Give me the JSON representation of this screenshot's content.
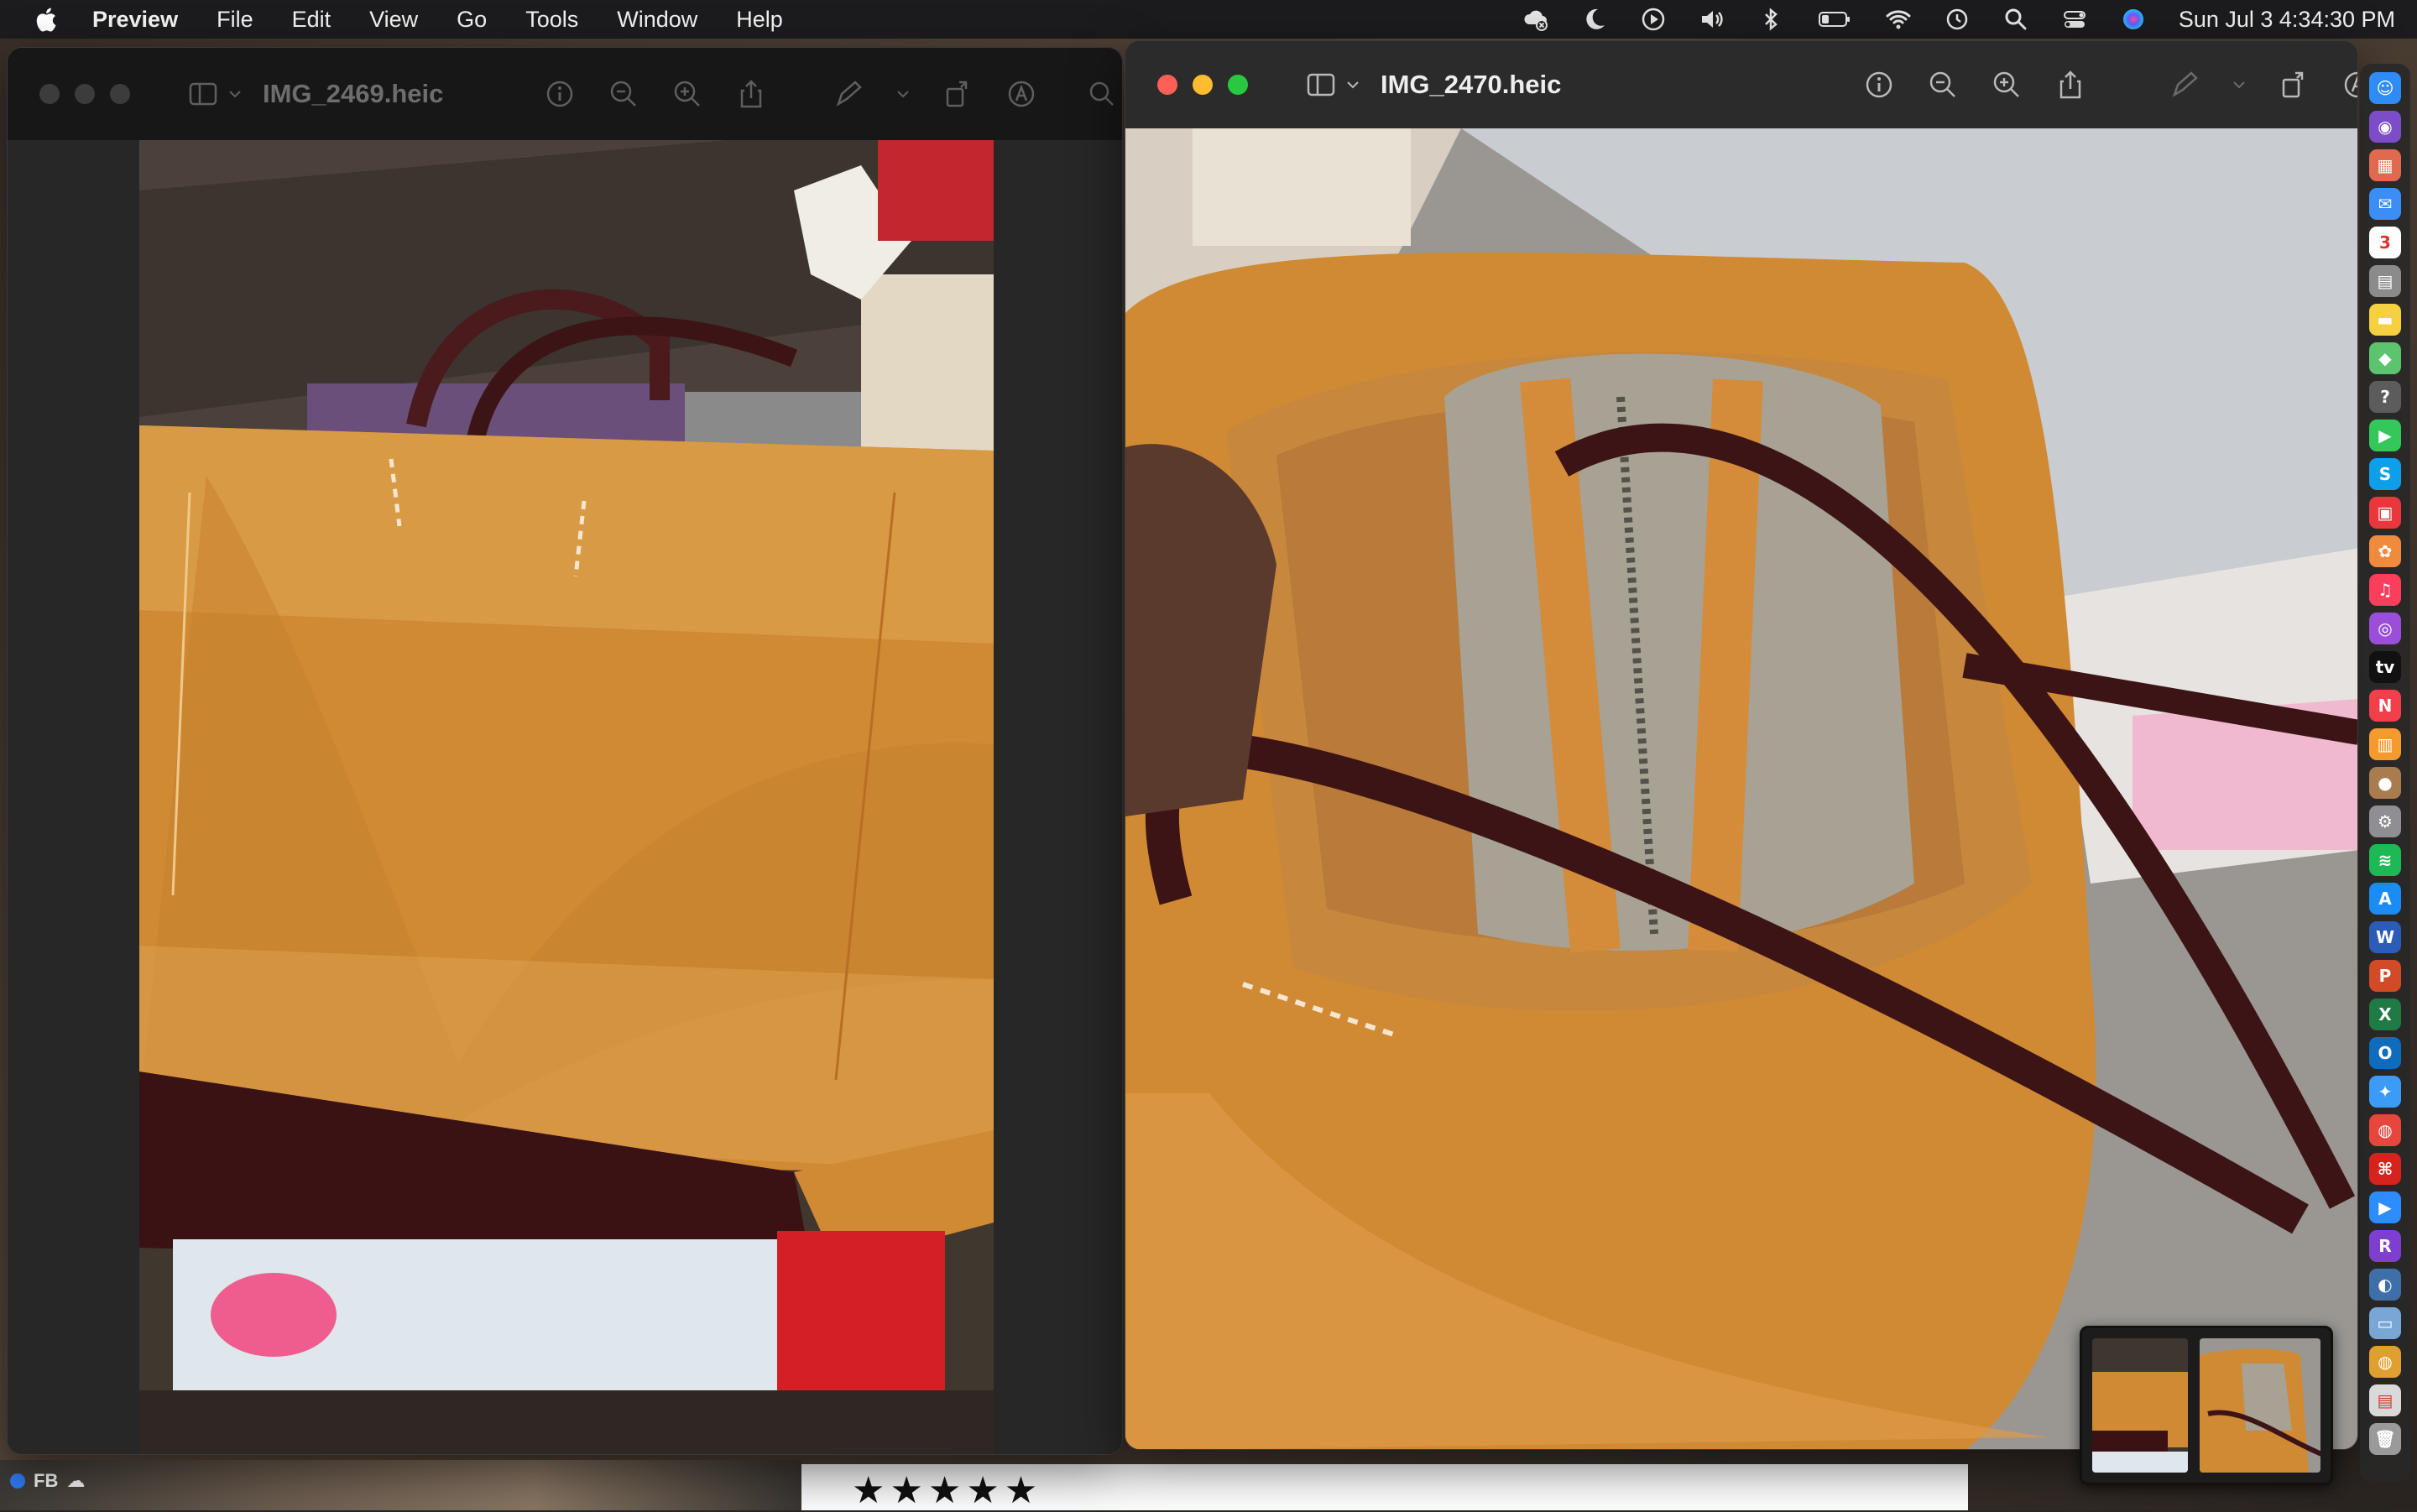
{
  "menubar": {
    "app_name": "Preview",
    "menus": [
      "File",
      "Edit",
      "View",
      "Go",
      "Tools",
      "Window",
      "Help"
    ],
    "clock": "Sun Jul 3  4:34:30 PM",
    "status_icons": [
      "icloud-error-icon",
      "moon-icon",
      "play-icon",
      "volume-icon",
      "bluetooth-icon",
      "battery-icon",
      "wifi-icon",
      "time-machine-icon",
      "search-icon",
      "control-center-icon",
      "siri-icon"
    ]
  },
  "windows": {
    "left": {
      "title": "IMG_2469.heic",
      "active": false
    },
    "right": {
      "title": "IMG_2470.heic",
      "active": true
    }
  },
  "toolbar_icons": [
    "info-icon",
    "zoom-out-icon",
    "zoom-in-icon",
    "share-icon",
    "markup-icon",
    "markup-chevron-icon",
    "rotate-icon",
    "annotate-icon"
  ],
  "desktop": {
    "fb_label": "FB",
    "stars": "★★★★★"
  },
  "dock": {
    "apps": [
      {
        "name": "finder",
        "glyph": "☺",
        "color": "#2f8cf6"
      },
      {
        "name": "siri",
        "glyph": "◉",
        "color": "#7d4cc8"
      },
      {
        "name": "launchpad",
        "glyph": "▦",
        "color": "#e06a4f"
      },
      {
        "name": "mail",
        "glyph": "✉",
        "color": "#3a8ef6"
      },
      {
        "name": "calendar",
        "glyph": "3",
        "color": "#ffffff"
      },
      {
        "name": "calculator",
        "glyph": "▤",
        "color": "#8b8b8b"
      },
      {
        "name": "notes",
        "glyph": "▬",
        "color": "#f5d142"
      },
      {
        "name": "maps",
        "glyph": "◆",
        "color": "#5cc46e"
      },
      {
        "name": "help",
        "glyph": "?",
        "color": "#5c5c5c"
      },
      {
        "name": "facetime",
        "glyph": "▶",
        "color": "#34c759"
      },
      {
        "name": "skype",
        "glyph": "S",
        "color": "#0e9fe8"
      },
      {
        "name": "photo-booth",
        "glyph": "▣",
        "color": "#e8383d"
      },
      {
        "name": "photos",
        "glyph": "✿",
        "color": "#f08a3c"
      },
      {
        "name": "music",
        "glyph": "♫",
        "color": "#fa3e5c"
      },
      {
        "name": "podcasts",
        "glyph": "◎",
        "color": "#9b4fd9"
      },
      {
        "name": "tv",
        "glyph": "tv",
        "color": "#111111"
      },
      {
        "name": "news",
        "glyph": "N",
        "color": "#f1404b"
      },
      {
        "name": "books",
        "glyph": "▥",
        "color": "#f59a2e"
      },
      {
        "name": "finder-dog",
        "glyph": "●",
        "color": "#a97c4f"
      },
      {
        "name": "system-preferences",
        "glyph": "⚙",
        "color": "#8e8e93"
      },
      {
        "name": "spotify",
        "glyph": "≋",
        "color": "#1db954"
      },
      {
        "name": "app-store",
        "glyph": "A",
        "color": "#1a8cf5"
      },
      {
        "name": "word",
        "glyph": "W",
        "color": "#2b5cb8"
      },
      {
        "name": "powerpoint",
        "glyph": "P",
        "color": "#d14b27"
      },
      {
        "name": "excel",
        "glyph": "X",
        "color": "#1f7a45"
      },
      {
        "name": "outlook",
        "glyph": "O",
        "color": "#0f6cbd"
      },
      {
        "name": "safari",
        "glyph": "✦",
        "color": "#3b9bf6"
      },
      {
        "name": "chrome",
        "glyph": "◍",
        "color": "#e8453c"
      },
      {
        "name": "acrobat",
        "glyph": "⌘",
        "color": "#d6231e"
      },
      {
        "name": "zoom",
        "glyph": "▶",
        "color": "#2d8cff"
      },
      {
        "name": "r-app",
        "glyph": "R",
        "color": "#7e3fd0"
      },
      {
        "name": "lens",
        "glyph": "◐",
        "color": "#3f6fa8"
      },
      {
        "name": "preview",
        "glyph": "▭",
        "color": "#7aa6d6"
      },
      {
        "name": "chrome-2",
        "glyph": "◍",
        "color": "#e0a030"
      },
      {
        "name": "downloads",
        "glyph": "▤",
        "color": "#d9d9d9"
      },
      {
        "name": "trash",
        "glyph": "🗑",
        "color": "#9a9a9a"
      }
    ]
  }
}
